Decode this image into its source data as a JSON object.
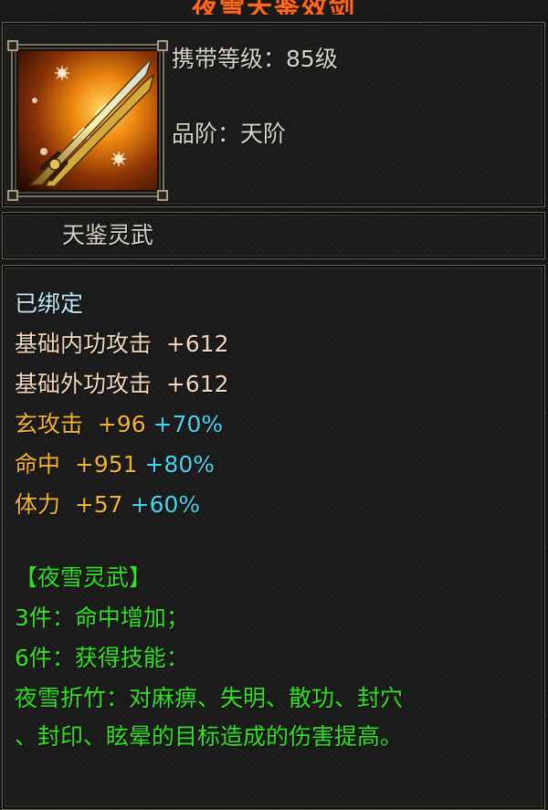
{
  "item": {
    "title": "夜雪天鉴效剑",
    "name": "天鉴灵武",
    "icon": "golden-twin-sword-icon",
    "carry_level_label": "携带等级：",
    "carry_level_value": "85级",
    "grade_label": "品阶：",
    "grade_value": "天阶"
  },
  "status": {
    "bound": "已绑定"
  },
  "stats": {
    "base": [
      {
        "label": "基础内功攻击",
        "value": "+612"
      },
      {
        "label": "基础外功攻击",
        "value": "+612"
      }
    ],
    "bonus": [
      {
        "label": "玄攻击",
        "value": "+96",
        "pct": "+70%"
      },
      {
        "label": "命中",
        "value": "+951",
        "pct": "+80%"
      },
      {
        "label": "体力",
        "value": "+57",
        "pct": "+60%"
      }
    ]
  },
  "set": {
    "name": "【夜雪灵武】",
    "bonus_3": "3件：命中增加；",
    "bonus_6": "6件：获得技能：",
    "skill_line1": "夜雪折竹：对麻痹、失明、散功、封穴",
    "skill_line2": "、封印、眩晕的目标造成的伤害提高。"
  },
  "colors": {
    "title": "#ff6a1a",
    "bound": "#bfe9f5",
    "base_stat": "#f2d7b8",
    "bonus_stat": "#f5b52a",
    "percent": "#41d8f0",
    "set_text": "#2ee41e"
  }
}
